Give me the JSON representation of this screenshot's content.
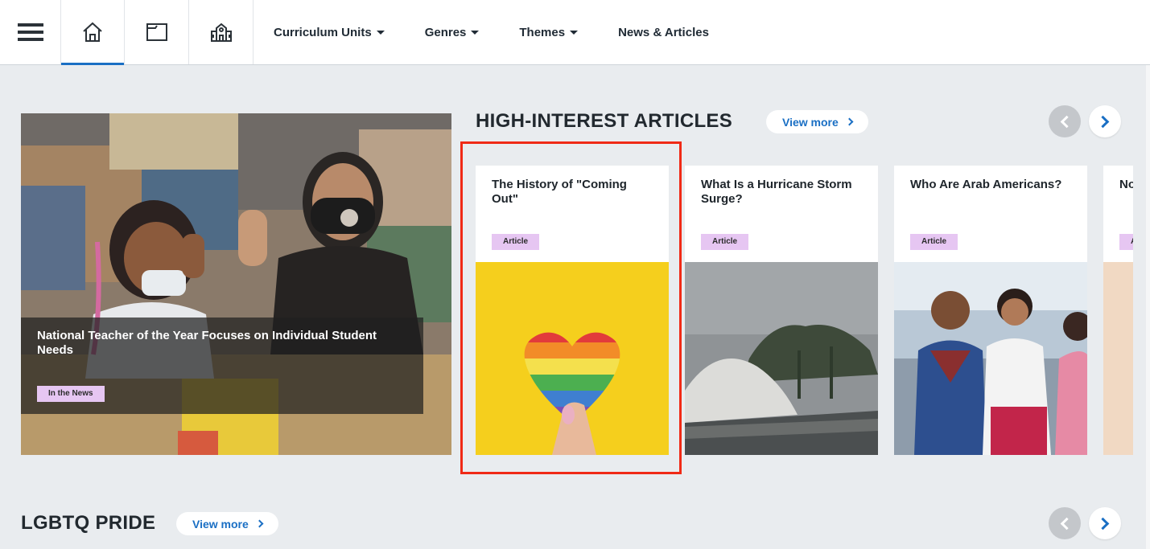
{
  "nav": {
    "links": [
      {
        "label": "Curriculum Units",
        "dropdown": true
      },
      {
        "label": "Genres",
        "dropdown": true
      },
      {
        "label": "Themes",
        "dropdown": true
      },
      {
        "label": "News & Articles",
        "dropdown": false
      }
    ]
  },
  "featured": {
    "title": "National Teacher of the Year Focuses on Individual Student Needs",
    "tag": "In the News"
  },
  "high_interest": {
    "title": "HIGH-INTEREST ARTICLES",
    "view_more": "View more",
    "cards": [
      {
        "title": "The History of \"Coming Out\"",
        "tag": "Article"
      },
      {
        "title": "What Is a Hurricane Storm Surge?",
        "tag": "Article"
      },
      {
        "title": "Who Are Arab Americans?",
        "tag": "Article"
      },
      {
        "title": "No an",
        "tag": "Article"
      }
    ]
  },
  "lgbtq": {
    "title": "LGBTQ PRIDE",
    "view_more": "View more"
  },
  "colors": {
    "accent": "#1a6fc4",
    "tag_bg": "#e6c6f2",
    "highlight": "#f02a16"
  }
}
